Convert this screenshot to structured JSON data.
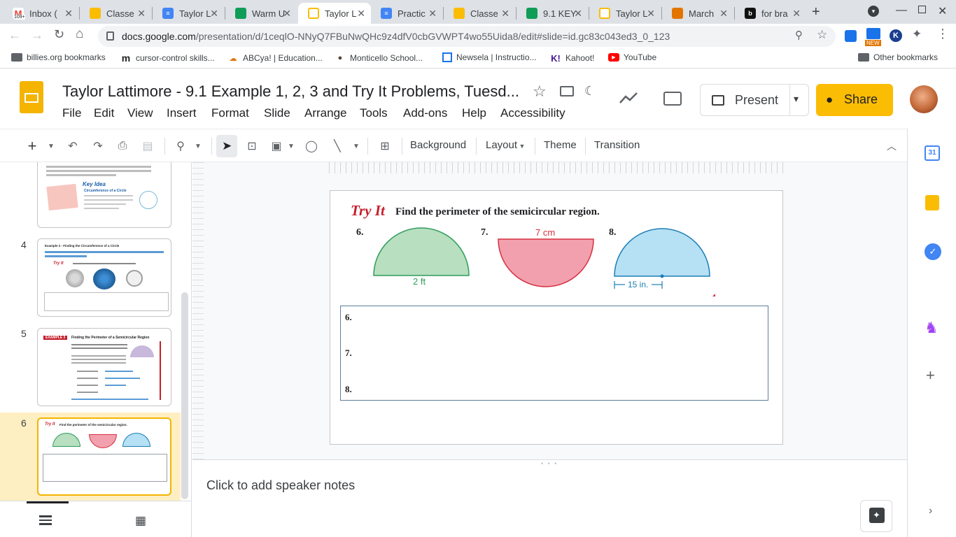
{
  "browser": {
    "tabs": [
      {
        "title": "Inbox (",
        "color": "#ea4335",
        "glyph": "M"
      },
      {
        "title": "Classe",
        "color": "#fbbc04",
        "glyph": ""
      },
      {
        "title": "Taylor L",
        "color": "#4285f4",
        "glyph": ""
      },
      {
        "title": "Warm U",
        "color": "#0f9d58",
        "glyph": ""
      },
      {
        "title": "Taylor L",
        "color": "#fbbc04",
        "glyph": "",
        "active": true
      },
      {
        "title": "Practic",
        "color": "#4285f4",
        "glyph": ""
      },
      {
        "title": "Classe",
        "color": "#fbbc04",
        "glyph": ""
      },
      {
        "title": "9.1 KEY",
        "color": "#0f9d58",
        "glyph": ""
      },
      {
        "title": "Taylor L",
        "color": "#fbbc04",
        "glyph": ""
      },
      {
        "title": "March",
        "color": "#e37400",
        "glyph": ""
      },
      {
        "title": "for bra",
        "color": "#111111",
        "glyph": "b"
      }
    ],
    "inbox_badge": "109+",
    "url_host": "docs.google.com",
    "url_path": "/presentation/d/1ceqlO-NNyQ7FBuNwQHc9z4dfV0cbGVWPT4wo55Uida8/edit#slide=id.gc83c043ed3_0_123",
    "new_badge": "NEW",
    "bookmarks": [
      {
        "label": "billies.org bookmarks",
        "icon": "folder-icon"
      },
      {
        "label": "cursor-control skills...",
        "icon": "m-icon"
      },
      {
        "label": "ABCya! | Education...",
        "icon": "abcya-icon"
      },
      {
        "label": "Monticello School...",
        "icon": "school-icon"
      },
      {
        "label": "Newsela | Instructio...",
        "icon": "newsela-icon"
      },
      {
        "label": "Kahoot!",
        "icon": "kahoot-icon"
      },
      {
        "label": "YouTube",
        "icon": "youtube-icon"
      }
    ],
    "other_bookmarks": "Other bookmarks"
  },
  "doc": {
    "title": "Taylor Lattimore - 9.1 Example 1, 2, 3 and Try It Problems, Tuesd...",
    "menus": [
      "File",
      "Edit",
      "View",
      "Insert",
      "Format",
      "Slide",
      "Arrange",
      "Tools",
      "Add-ons",
      "Help",
      "Accessibility"
    ],
    "present_label": "Present",
    "share_label": "Share"
  },
  "toolbar": {
    "background": "Background",
    "layout": "Layout",
    "theme": "Theme",
    "transition": "Transition"
  },
  "filmstrip": {
    "slides": [
      {
        "number": "4",
        "title": "Example 2 - Finding the Circumference of a Circle"
      },
      {
        "number": "5",
        "title": "Finding the Perimeter of a Semicircular Region",
        "badge": "EXAMPLE 3"
      },
      {
        "number": "6",
        "title": "Find the perimeter of the semicircular region."
      }
    ],
    "thumb3_heading": "Key Idea",
    "thumb3_subheading": "Circumference of a Circle"
  },
  "slide": {
    "heading_tag": "Try It",
    "heading": "Find the perimeter of the semicircular region.",
    "problems": [
      {
        "num": "6.",
        "label": "2 ft",
        "color": "#b7dfc0",
        "stroke": "#2e9c5a"
      },
      {
        "num": "7.",
        "label": "7 cm",
        "color": "#f2a0ae",
        "stroke": "#d6303f"
      },
      {
        "num": "8.",
        "label": "15 in.",
        "color": "#b6e0f4",
        "stroke": "#1a7fb5"
      }
    ],
    "answer_lines": [
      "6.",
      "7.",
      "8."
    ]
  },
  "notes": {
    "placeholder": "Click to add speaker notes"
  },
  "colors": {
    "share_yellow": "#fbbc04",
    "selected_slide_bg": "#feefc3",
    "selected_slide_border": "#f4b400",
    "try_it_red": "#c41e2a"
  }
}
